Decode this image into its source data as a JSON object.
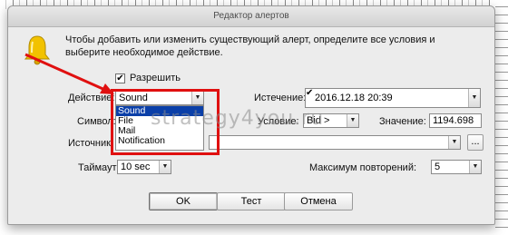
{
  "window": {
    "title": "Редактор алертов"
  },
  "info_text": "Чтобы добавить или изменить существующий алерт, определите все условия и выберите необходимое действие.",
  "enable": {
    "label": "Разрешить",
    "checked": true
  },
  "action": {
    "label": "Действие:",
    "value": "Sound",
    "options": [
      "Sound",
      "File",
      "Mail",
      "Notification"
    ],
    "selected_index": 0
  },
  "expiration": {
    "label": "Истечение:",
    "value": "2016.12.18 20:39"
  },
  "symbol": {
    "label": "Символ:"
  },
  "condition": {
    "label": "Условие:",
    "value": "Bid >"
  },
  "value_field": {
    "label": "Значение:",
    "value": "1194.698"
  },
  "source": {
    "label": "Источник",
    "browse": "..."
  },
  "timeout": {
    "label": "Таймаут:",
    "value": "10 sec"
  },
  "max_repeats": {
    "label": "Максимум повторений:",
    "value": "5"
  },
  "buttons": {
    "ok": "OK",
    "test": "Тест",
    "cancel": "Отмена"
  },
  "watermark": "strategy4you.ru",
  "colors": {
    "highlight": "#0a3fa8",
    "annotation": "#e01010"
  }
}
